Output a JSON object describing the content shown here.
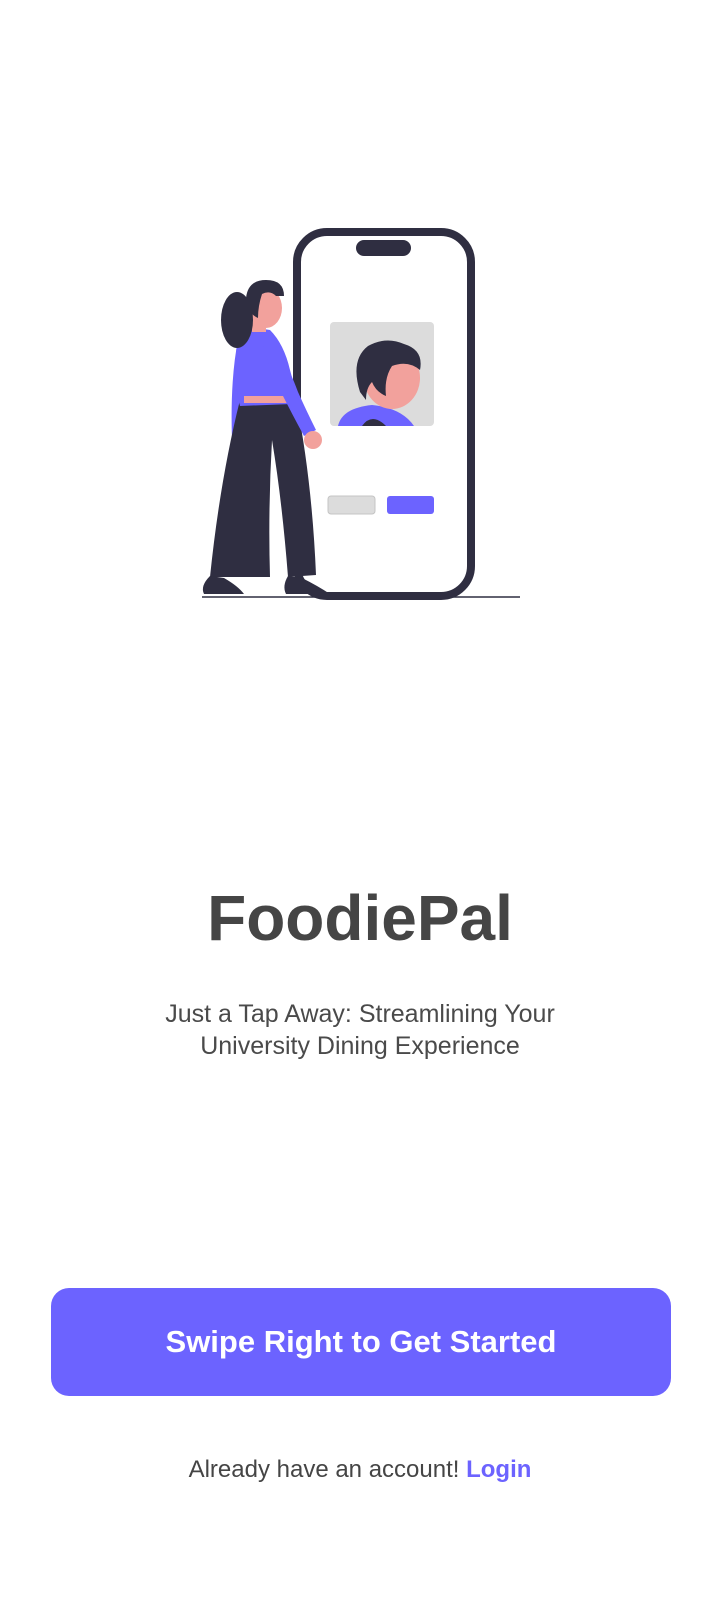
{
  "app": {
    "title": "FoodiePal",
    "tagline_line1": "Just a Tap Away: Streamlining Your",
    "tagline_line2": "University Dining Experience"
  },
  "cta": {
    "label": "Swipe Right to Get Started"
  },
  "login": {
    "prompt": "Already have an account!",
    "link_label": "Login"
  },
  "illustration": {
    "icon": "woman-with-phone-profile-illustration"
  },
  "colors": {
    "accent": "#6c63ff",
    "text_dark": "#454545",
    "ink": "#2f2e41",
    "skin": "#f2a19c",
    "card_gray": "#dcdcdc",
    "background": "#ffffff"
  }
}
